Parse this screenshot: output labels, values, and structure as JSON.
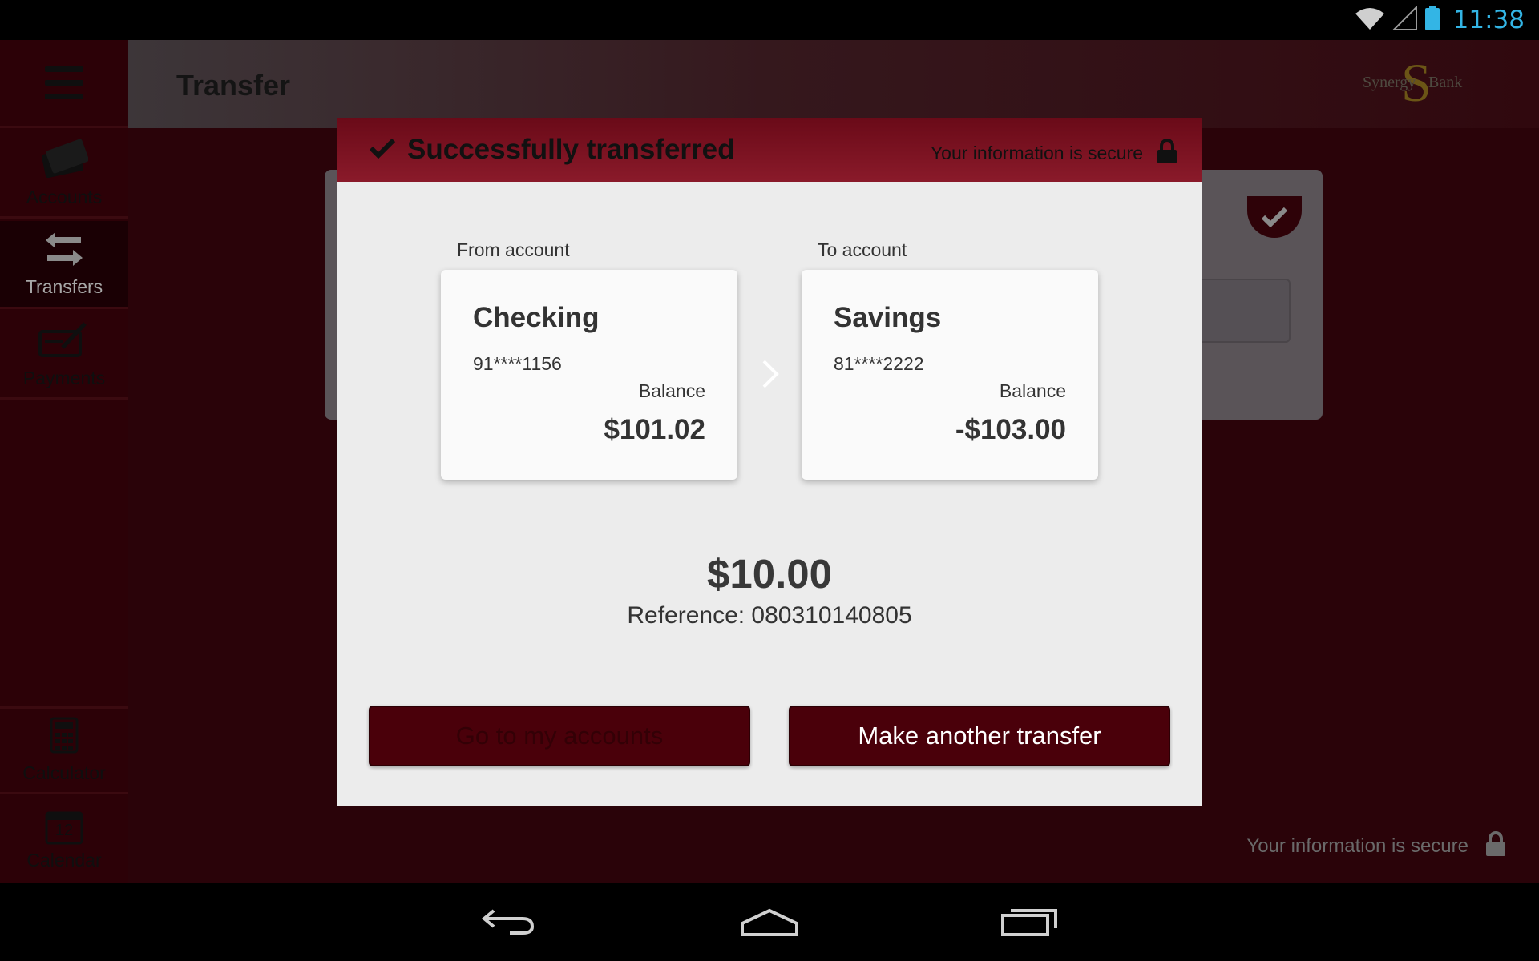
{
  "status_bar": {
    "time": "11:38",
    "icons": [
      "wifi-icon",
      "signal-icon",
      "battery-icon"
    ],
    "time_color": "#33b5e5"
  },
  "sidebar": {
    "items": [
      {
        "label": "Accounts",
        "icon": "card-icon"
      },
      {
        "label": "Transfers",
        "icon": "transfer-arrows-icon",
        "active": true
      },
      {
        "label": "Payments",
        "icon": "check-pen-icon"
      },
      {
        "label": "Calculator",
        "icon": "calculator-icon"
      },
      {
        "label": "Calendar",
        "icon": "calendar-icon",
        "badge": "12"
      }
    ]
  },
  "header": {
    "title": "Transfer",
    "logo": {
      "left": "Synergy",
      "right": "Bank",
      "mark": "S"
    }
  },
  "footer": {
    "secure_text": "Your information is secure"
  },
  "modal": {
    "title": "Successfully transferred",
    "secure_text": "Your information is secure",
    "from": {
      "label": "From account",
      "name": "Checking",
      "number": "91****1156",
      "balance_label": "Balance",
      "balance": "$101.02"
    },
    "to": {
      "label": "To account",
      "name": "Savings",
      "number": "81****2222",
      "balance_label": "Balance",
      "balance": "-$103.00"
    },
    "amount": "$10.00",
    "reference": "Reference: 080310140805",
    "buttons": {
      "accounts": "Go to my accounts",
      "another": "Make another transfer"
    }
  },
  "colors": {
    "brand": "#4a000a",
    "header_red": "#8a1a2a",
    "background": "#2a0309"
  }
}
